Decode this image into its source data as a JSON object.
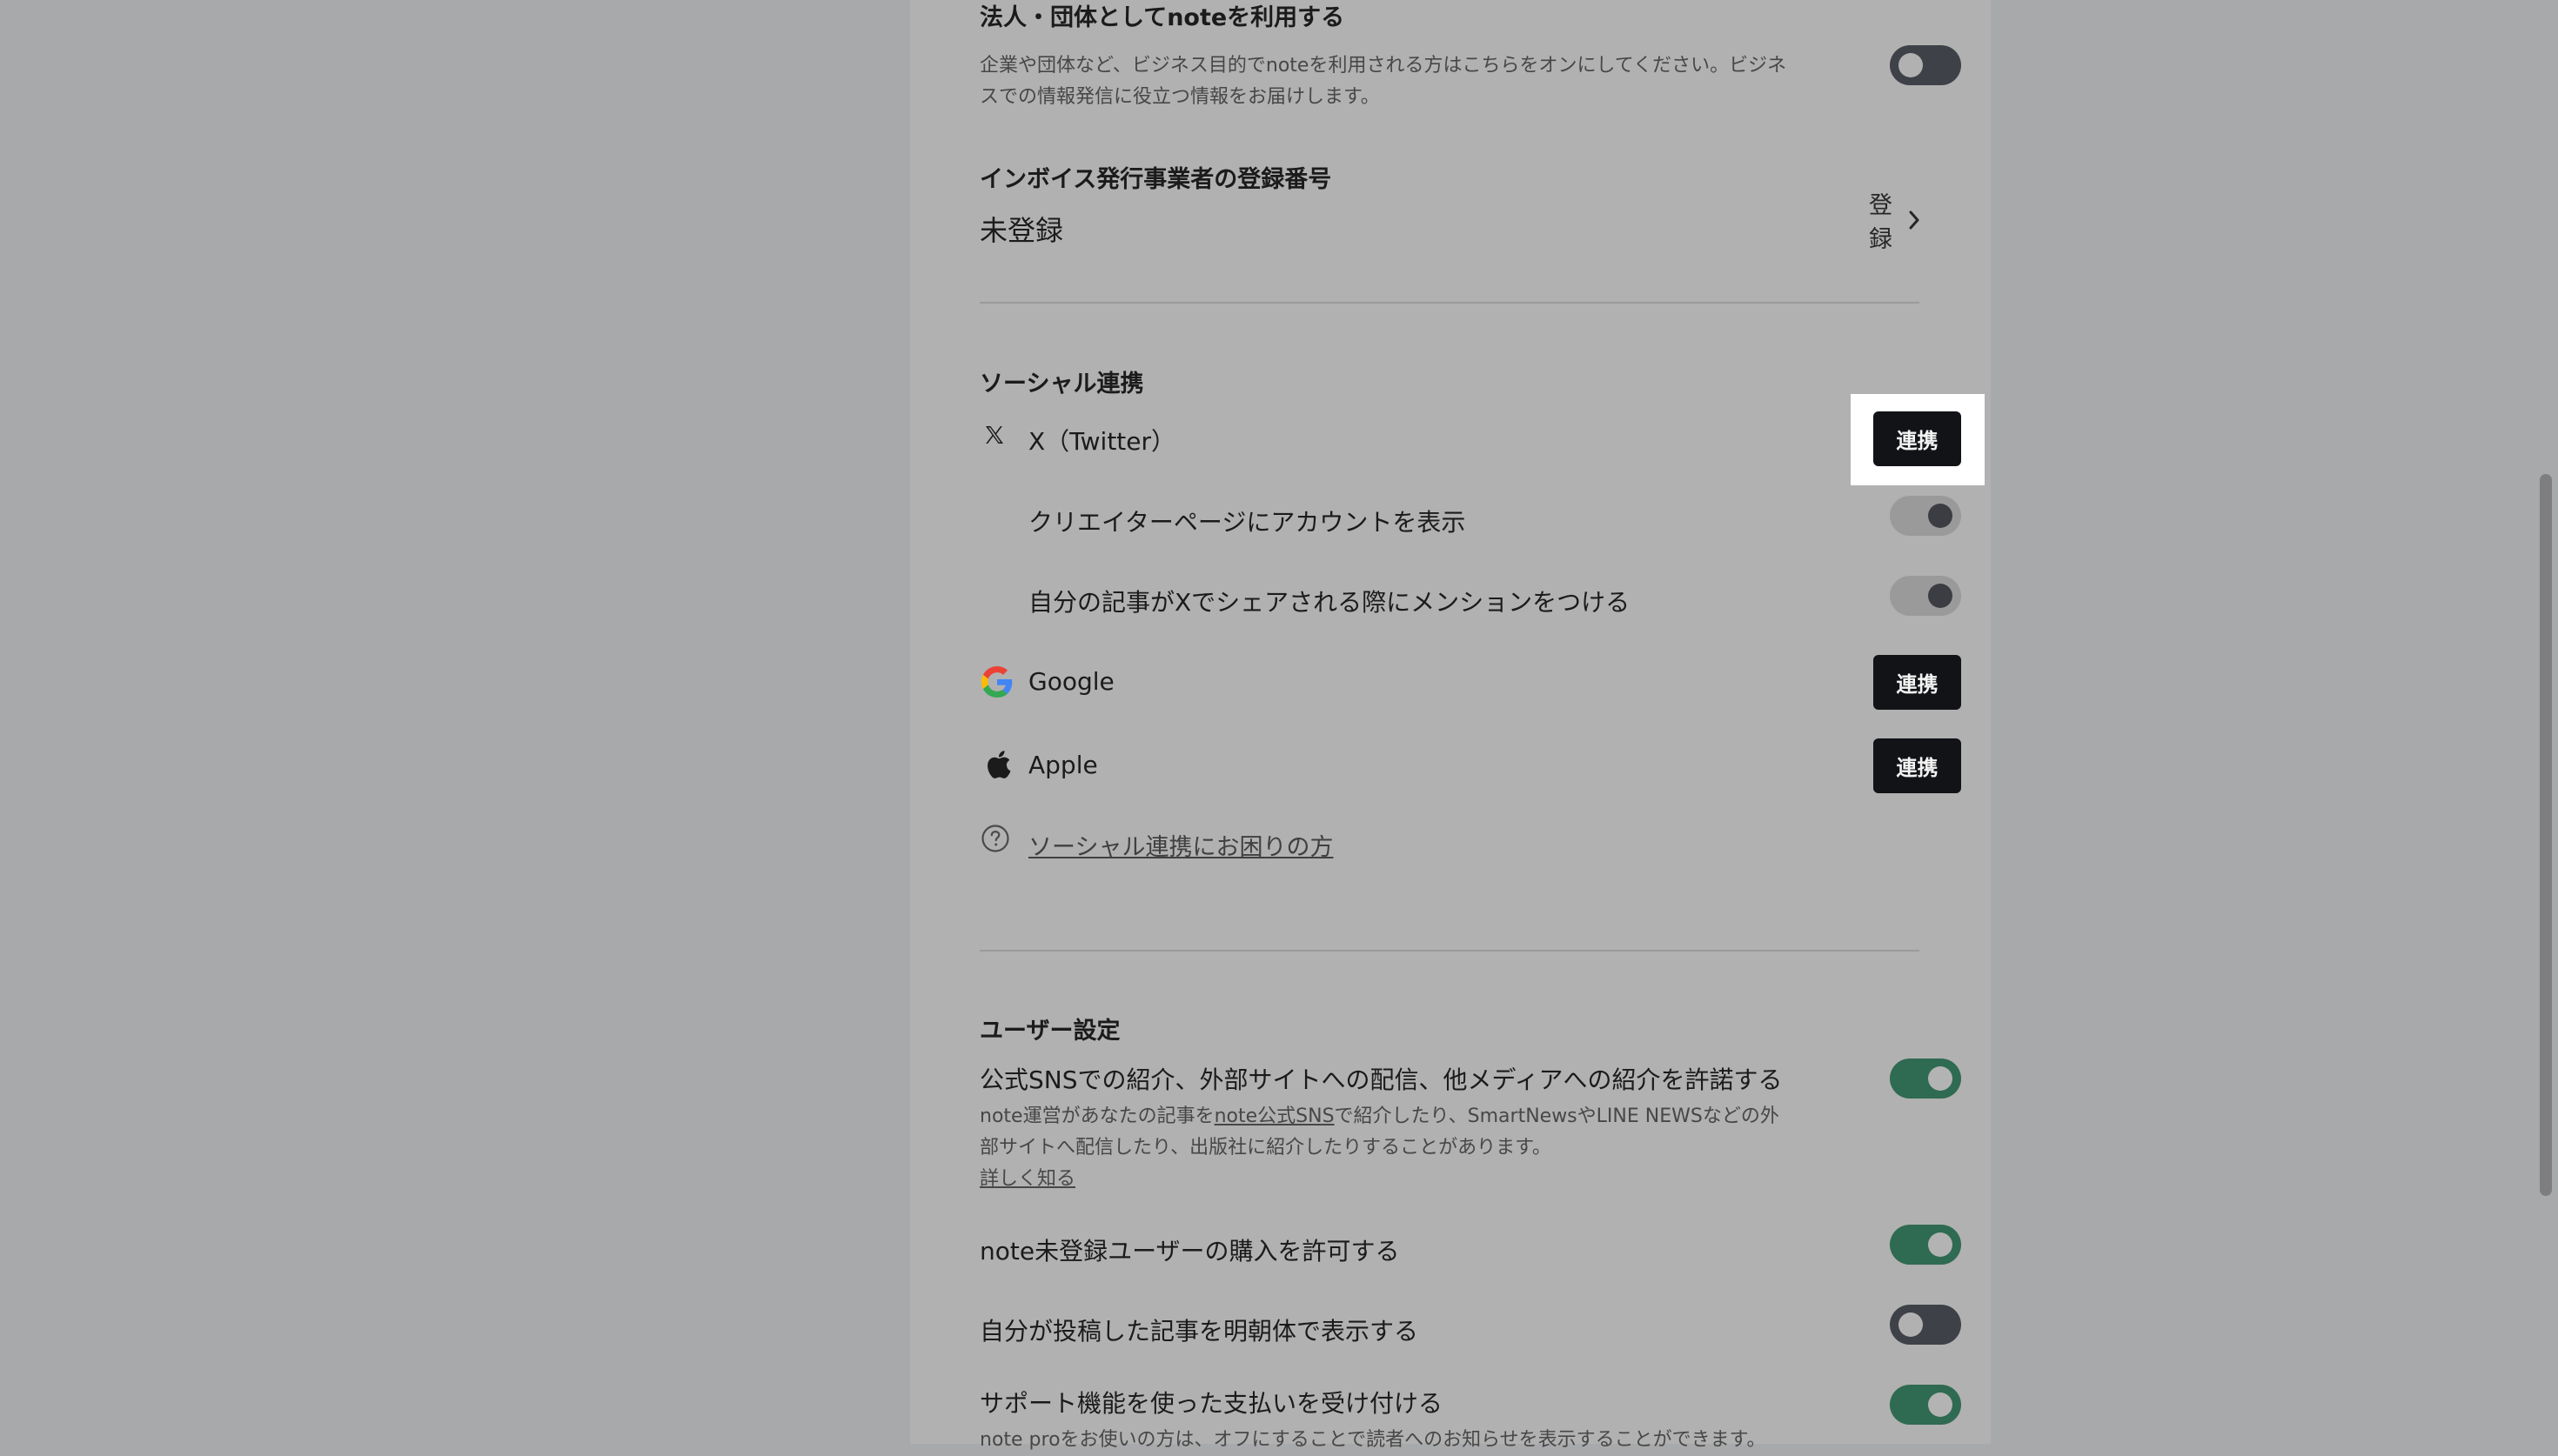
{
  "corporate": {
    "title": "法人・団体としてnoteを利用する",
    "description": "企業や団体など、ビジネス目的でnoteを利用される方はこちらをオンにしてください。ビジネスでの情報発信に役立つ情報をお届けします。",
    "enabled": false
  },
  "invoice": {
    "title": "インボイス発行事業者の登録番号",
    "status": "未登録",
    "action_label": "登録"
  },
  "social": {
    "title": "ソーシャル連携",
    "twitter": {
      "label": "X（Twitter）",
      "button_label": "連携",
      "sub_options": [
        {
          "label": "クリエイターページにアカウントを表示",
          "enabled": true,
          "disabled": true
        },
        {
          "label": "自分の記事がXでシェアされる際にメンションをつける",
          "enabled": true,
          "disabled": true
        }
      ]
    },
    "google": {
      "label": "Google",
      "button_label": "連携"
    },
    "apple": {
      "label": "Apple",
      "button_label": "連携"
    },
    "help_link": "ソーシャル連携にお困りの方"
  },
  "user_settings": {
    "title": "ユーザー設定",
    "items": [
      {
        "label": "公式SNSでの紹介、外部サイトへの配信、他メディアへの紹介を許諾する",
        "desc_pre": "note運営があなたの記事を",
        "desc_link": "note公式SNS",
        "desc_post": "で紹介したり、SmartNewsやLINE NEWSなどの外部サイトへ配信したり、出版社に紹介したりすることがあります。",
        "more_link": "詳しく知る",
        "enabled": true
      },
      {
        "label": "note未登録ユーザーの購入を許可する",
        "enabled": true
      },
      {
        "label": "自分が投稿した記事を明朝体で表示する",
        "enabled": false
      },
      {
        "label": "サポート機能を使った支払いを受け付ける",
        "description": "note proをお使いの方は、オフにすることで読者へのお知らせを表示することができます。",
        "enabled": true
      }
    ]
  },
  "colors": {
    "overlay_bg": "#a8a9ab",
    "panel_bg": "#b1b1b1",
    "toggle_on": "#2f6a52",
    "toggle_off": "#3e4147",
    "button_bg": "#111317"
  }
}
